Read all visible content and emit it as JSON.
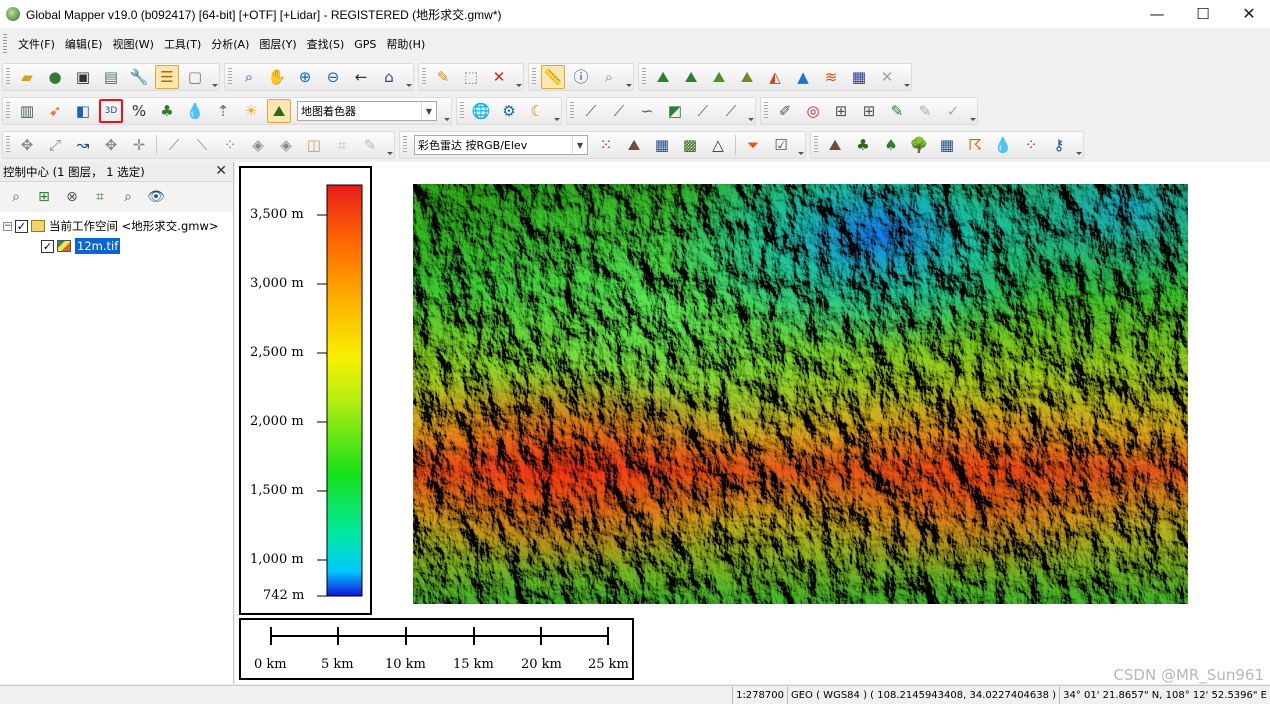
{
  "window": {
    "title": "Global Mapper v19.0 (b092417) [64-bit] [+OTF] [+Lidar] - REGISTERED (地形求交.gmw*)",
    "minimize": "—",
    "maximize": "☐",
    "close": "✕"
  },
  "menubar": {
    "items": [
      "文件(F)",
      "编辑(E)",
      "视图(W)",
      "工具(T)",
      "分析(A)",
      "图层(Y)",
      "查找(S)",
      "GPS",
      "帮助(H)"
    ]
  },
  "toolbars": {
    "shader_combo": "地图着色器",
    "lidar_combo": "彩色雷达 按RGB/Elev",
    "combo_arrow": "▼"
  },
  "control_center": {
    "title": "控制中心 (1 图层， 1 选定)",
    "close": "✕",
    "workspace_label": "当前工作空间 <地形求交.gmw>",
    "layer_label": "12m.tif",
    "expander": "−",
    "check": "✓"
  },
  "map": {
    "legend": {
      "labels": [
        "3,500 m",
        "3,000 m",
        "2,500 m",
        "2,000 m",
        "1,500 m",
        "1,000 m",
        "742 m"
      ]
    },
    "scale": {
      "labels": [
        "0 km",
        "5 km",
        "10 km",
        "15 km",
        "20 km",
        "25 km"
      ]
    }
  },
  "status": {
    "scale": "1:278700",
    "coords": "GEO ( WGS84 ) ( 108.2145943408, 34.0227404638 )",
    "dms": "34° 01' 21.8657\" N, 108° 12' 52.5396\" E"
  },
  "watermark": "CSDN @MR_Sun961"
}
